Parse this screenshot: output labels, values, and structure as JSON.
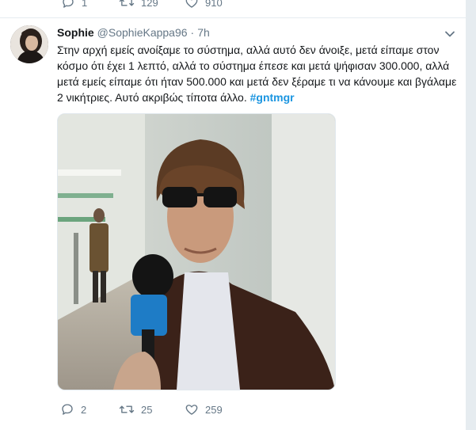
{
  "previous_tweet": {
    "reply_count": "1",
    "retweet_count": "129",
    "like_count": "910"
  },
  "tweet": {
    "author_name": "Sophie",
    "author_handle": "@SophieKappa96",
    "separator": "·",
    "time": "7h",
    "text": "Στην αρχή εμείς ανοίξαμε το σύστημα, αλλά αυτό δεν άνοιξε, μετά είπαμε στον κόσμο ότι έχει 1 λεπτό, αλλά το σύστημα έπεσε και μετά ψήφισαν 300.000, αλλά μετά εμείς είπαμε ότι ήταν 500.000 και μετά δεν ξέραμε τι να κάνουμε και βγάλαμε 2 νικήτριες. Αυτό ακριβώς τίποτα άλλο.",
    "hashtag": "#gntmgr",
    "reply_count": "2",
    "retweet_count": "25",
    "like_count": "259"
  },
  "colors": {
    "accent": "#1b95e0",
    "muted": "#657786"
  },
  "icons": {
    "reply": "reply-icon",
    "retweet": "retweet-icon",
    "like": "heart-icon",
    "menu": "chevron-down-icon"
  }
}
